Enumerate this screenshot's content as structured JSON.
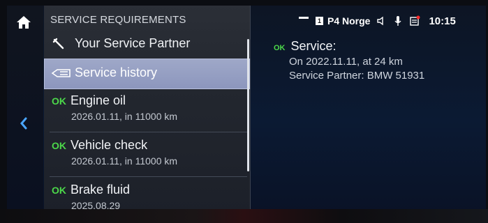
{
  "header": {
    "title": "SERVICE REQUIREMENTS"
  },
  "status_bar": {
    "station": "P4 Norge",
    "time": "10:15",
    "badge": "1"
  },
  "menu": {
    "partner_label": "Your Service Partner",
    "history_label": "Service history",
    "ok_text": "OK",
    "items": [
      {
        "label": "Engine oil",
        "sub": "2026.01.11, in 11000 km"
      },
      {
        "label": "Vehicle check",
        "sub": "2026.01.11, in 11000 km"
      },
      {
        "label": "Brake fluid",
        "sub": "2025.08.29"
      }
    ]
  },
  "detail": {
    "ok_text": "OK",
    "title": "Service:",
    "line1": "On 2022.11.11, at 24 km",
    "line2": "Service Partner: BMW 51931"
  },
  "colors": {
    "ok": "#4cd94a",
    "highlight": "#9fa8c8"
  }
}
